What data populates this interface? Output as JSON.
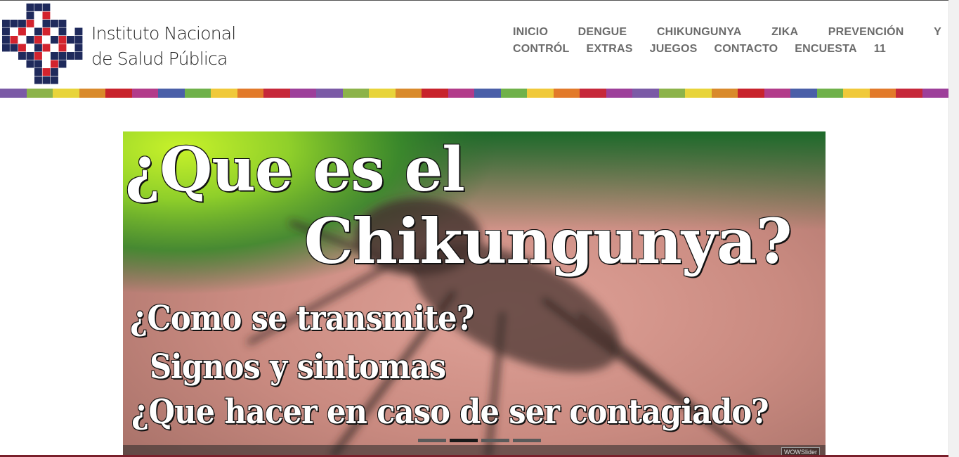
{
  "logo": {
    "line1": "Instituto Nacional",
    "line2": "de Salud Pública"
  },
  "nav": {
    "row1": [
      "INICIO",
      "DENGUE",
      "CHIKUNGUNYA",
      "ZIKA",
      "PREVENCIÓN",
      "Y"
    ],
    "row2": [
      "CONTRÓL",
      "EXTRAS",
      "JUEGOS",
      "CONTACTO",
      "ENCUESTA",
      "11"
    ]
  },
  "colors": {
    "nav_text": "#6b6b6b",
    "logo_navy": "#1f2a5c",
    "logo_red": "#d3232e",
    "strip": [
      "#7b5aa6",
      "#8cb34a",
      "#e8d43a",
      "#d98a2b",
      "#c8232c",
      "#b23b8a",
      "#4a5fa8",
      "#6fb14a",
      "#f0c93a",
      "#e27a2a",
      "#c6283a",
      "#9d3f9a"
    ]
  },
  "slider": {
    "line1": "¿Que es el",
    "line2": "Chikungunya?",
    "line3": "¿Como se transmite?",
    "line4": "Signos y sintomas",
    "line5": "¿Que hacer en caso de ser contagiado?",
    "bullets": 4,
    "active_bullet": 2,
    "badge": "WOWSlider"
  }
}
